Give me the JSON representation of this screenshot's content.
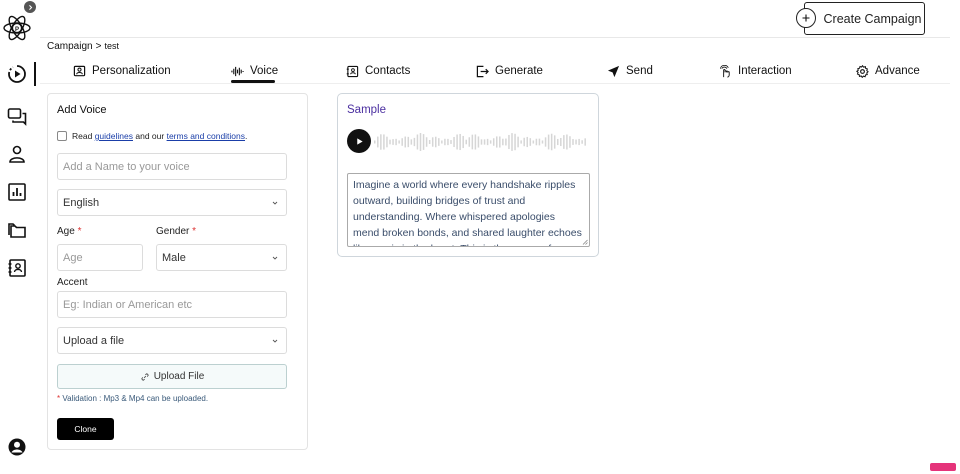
{
  "header": {
    "create_campaign_label": "Create Campaign",
    "breadcrumb": {
      "root": "Campaign",
      "separator": ">",
      "current": "test"
    }
  },
  "tabs": [
    {
      "label": "Personalization",
      "icon": "personalization-icon"
    },
    {
      "label": "Voice",
      "icon": "voice-waveform-icon",
      "active": true
    },
    {
      "label": "Contacts",
      "icon": "contacts-icon"
    },
    {
      "label": "Generate",
      "icon": "generate-icon"
    },
    {
      "label": "Send",
      "icon": "send-icon"
    },
    {
      "label": "Interaction",
      "icon": "interaction-icon"
    },
    {
      "label": "Advance",
      "icon": "gear-icon"
    }
  ],
  "add_voice": {
    "title": "Add Voice",
    "terms": {
      "prefix": "Read",
      "guidelines": "guidelines",
      "middle": "and our",
      "terms_link": "terms and conditions",
      "suffix": "."
    },
    "name_placeholder": "Add a Name to your voice",
    "language_value": "English",
    "age_label": "Age",
    "age_placeholder": "Age",
    "gender_label": "Gender",
    "gender_value": "Male",
    "accent_label": "Accent",
    "accent_placeholder": "Eg: Indian or American etc",
    "upload_select_value": "Upload a file",
    "upload_button_label": "Upload File",
    "required_marker": "*",
    "validation_text": "Validation : Mp3 & Mp4 can be uploaded.",
    "clone_label": "Clone"
  },
  "sample": {
    "title": "Sample",
    "text": "Imagine a world where every handshake ripples outward, building bridges of trust and understanding. Where whispered apologies mend broken bonds, and shared laughter echoes like music in the heart. This is the power of"
  },
  "colors": {
    "accent_purple": "#4b2fa0",
    "link_blue": "#1a3ea8",
    "required_red": "#d33333",
    "badge_pink": "#e5337a"
  }
}
